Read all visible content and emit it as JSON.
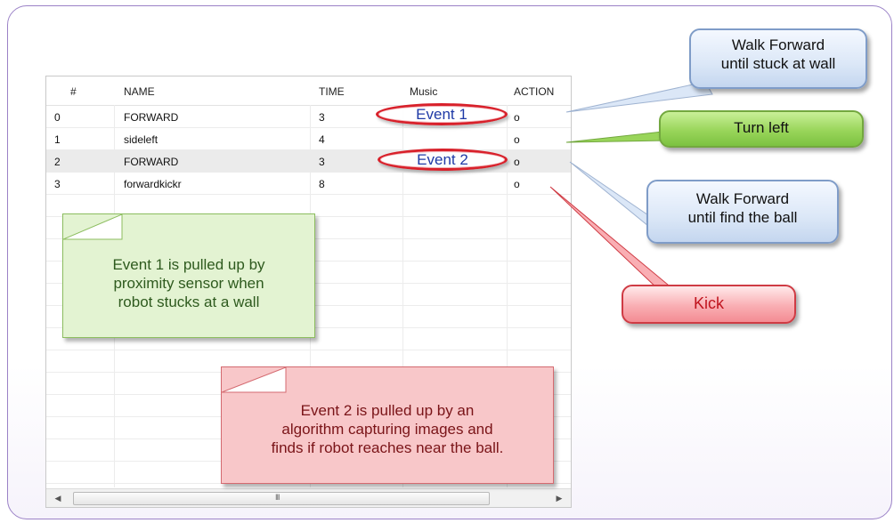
{
  "table": {
    "columns": [
      "#",
      "NAME",
      "TIME",
      "Music",
      "ACTION"
    ],
    "rows": [
      {
        "num": "0",
        "name": "FORWARD",
        "time": "3",
        "action": "o"
      },
      {
        "num": "1",
        "name": "sideleft",
        "time": "4",
        "action": "o"
      },
      {
        "num": "2",
        "name": "FORWARD",
        "time": "3",
        "action": "o"
      },
      {
        "num": "3",
        "name": "forwardkickr",
        "time": "8",
        "action": "o"
      }
    ],
    "selected_row": 2,
    "scrollbar_grip": "III"
  },
  "events": {
    "event1": "Event 1",
    "event2": "Event 2"
  },
  "callouts": {
    "walk_forward_wall": [
      "Walk Forward",
      "until stuck at wall"
    ],
    "turn_left": "Turn left",
    "walk_forward_ball": [
      "Walk Forward",
      "until find the ball"
    ],
    "kick": "Kick"
  },
  "notes": {
    "event1_note": [
      "Event 1 is pulled up by",
      "proximity sensor when",
      "robot stucks at a wall"
    ],
    "event2_note": [
      "Event 2 is pulled up by an",
      "algorithm capturing images and",
      "finds if robot reaches near the ball."
    ]
  },
  "colors": {
    "frame_border": "#9b82c7",
    "oval_red": "#d8202a",
    "event_text": "#1f3aa6",
    "callout_blue": "#dbe7f7",
    "callout_green": "#99d55a",
    "callout_red": "#f9aeb3",
    "note_green": "#e3f3d2",
    "note_red": "#f8c7c9"
  },
  "icons": [
    "scroll-left-icon",
    "scroll-right-icon"
  ]
}
